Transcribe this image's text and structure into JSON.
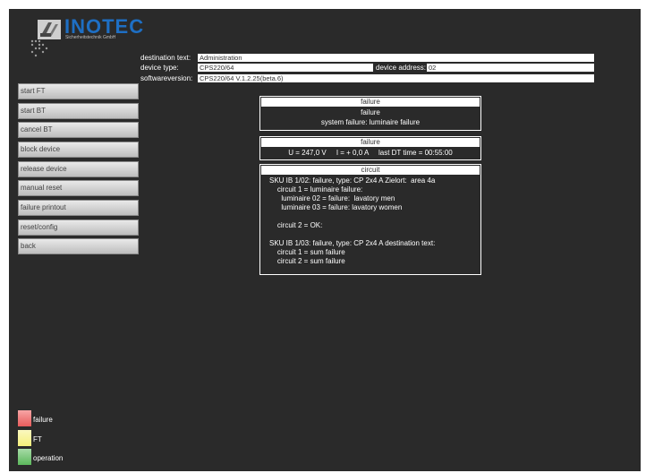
{
  "logo": {
    "brand": "INOTEC",
    "subtitle": "Sicherheitstechnik GmbH"
  },
  "info": {
    "destination_label": "destination text:",
    "destination_value": "Administration",
    "device_type_label": "device type:",
    "device_type_value": "CPS220/64",
    "device_address_label": "device address:",
    "device_address_value": "02",
    "software_label": "softwareversion:",
    "software_value": "CPS220/64 V.1.2.25(beta.6)"
  },
  "menu": [
    "start FT",
    "start BT",
    "cancel BT",
    "block device",
    "release device",
    "manual reset",
    "failure printout",
    "reset/config",
    "back"
  ],
  "failure_panel": {
    "header": "failure",
    "line1": "failure",
    "line2": "system failure: luminaire failure"
  },
  "measure_panel": {
    "header": "failure",
    "line": "U = 247,0 V     I = + 0,0 A     last DT time = 00:55:00"
  },
  "circuit_panel": {
    "header": "circuit",
    "lines": [
      "SKU IB 1/02: failure, type: CP 2x4 A Zielort:  area 4a",
      "    circuit 1 = luminaire failure:",
      "      luminaire 02 = failure:  lavatory men",
      "      luminaire 03 = failure: lavatory women",
      "",
      "    circuit 2 = OK:",
      "",
      "SKU IB 1/03: failure, type: CP 2x4 A destination text:",
      "    circuit 1 = sum failure",
      "    circuit 2 = sum failure"
    ]
  },
  "legend": [
    {
      "label": "failure",
      "color": "#e85c5c"
    },
    {
      "label": "FT",
      "color": "#f5f07a"
    },
    {
      "label": "operation",
      "color": "#5cb85c"
    }
  ]
}
